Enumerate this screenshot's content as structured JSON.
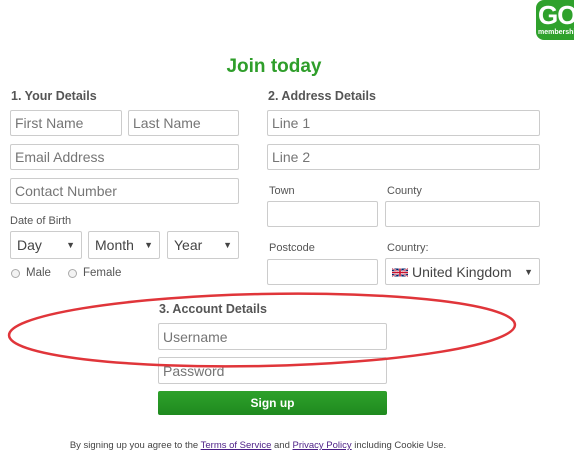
{
  "brand": {
    "logo_word": "GO!",
    "logo_sub": "membership",
    "color": "#2f9e2b"
  },
  "title": "Join today",
  "your_details": {
    "heading": "1. Your Details",
    "first_name_placeholder": "First Name",
    "last_name_placeholder": "Last Name",
    "email_placeholder": "Email Address",
    "contact_placeholder": "Contact Number",
    "dob_label": "Date of Birth",
    "day": "Day",
    "month": "Month",
    "year": "Year",
    "male": "Male",
    "female": "Female"
  },
  "address_details": {
    "heading": "2. Address Details",
    "line1_placeholder": "Line 1",
    "line2_placeholder": "Line 2",
    "town_label": "Town",
    "county_label": "County",
    "postcode_label": "Postcode",
    "country_label": "Country:",
    "country_value": "United Kingdom",
    "country_flag_icon": "uk-flag-icon"
  },
  "account_details": {
    "heading": "3. Account Details",
    "username_placeholder": "Username",
    "password_placeholder": "Password",
    "signup_label": "Sign up"
  },
  "legal": {
    "prefix": "By signing up you agree to the ",
    "terms": "Terms of Service",
    "and": " and ",
    "privacy": "Privacy Policy",
    "suffix": " including Cookie Use."
  },
  "annotation": {
    "ellipse_color": "#e0353a"
  }
}
